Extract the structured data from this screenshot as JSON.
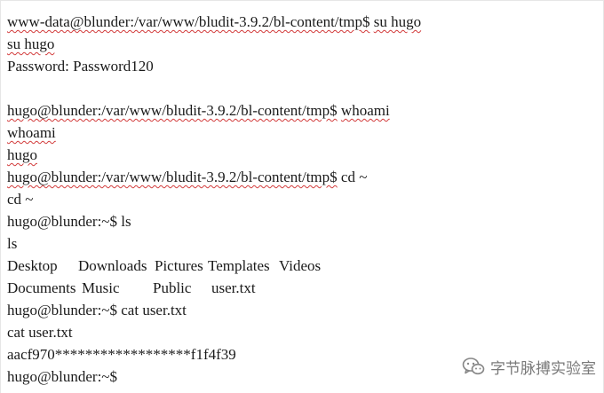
{
  "terminal": {
    "l1_prompt": "www-data@blunder:/var/www/bludit-3.9.2/bl-content/tmp$",
    "l1_cmd": "su hugo",
    "l2": "su hugo",
    "l3": "Password: Password120",
    "l5_prompt": "hugo@blunder:/var/www/bludit-3.9.2/bl-content/tmp$",
    "l5_cmd": "whoami",
    "l6": "whoami",
    "l7": "hugo",
    "l8_prompt": "hugo@blunder:/var/www/bludit-3.9.2/bl-content/tmp$",
    "l8_cmd": "cd ~",
    "l9": "cd ~",
    "l10": "hugo@blunder:~$ ls",
    "l11": "ls",
    "ls_row1": [
      "Desktop",
      "Downloads",
      "Pictures",
      "Templates",
      "Videos"
    ],
    "ls_row2": [
      "Documents",
      "Music",
      "Public",
      "user.txt"
    ],
    "l14": "hugo@blunder:~$ cat user.txt",
    "l15": "cat user.txt",
    "l16": "aacf970******************f1f4f39",
    "l17": "hugo@blunder:~$"
  },
  "watermark": {
    "text": "字节脉搏实验室",
    "icon": "wechat-icon"
  }
}
